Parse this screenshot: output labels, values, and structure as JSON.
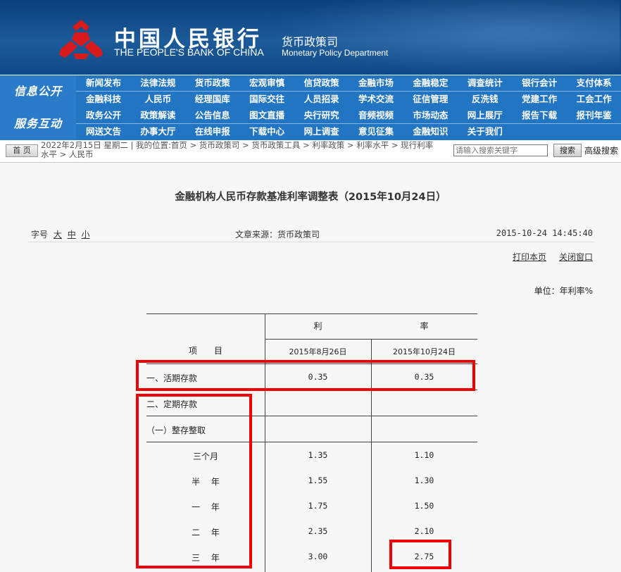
{
  "header": {
    "bank_name_cn": "中国人民银行",
    "bank_name_en": "THE PEOPLE'S BANK OF CHINA",
    "dept_cn": "货币政策司",
    "dept_en": "Monetary Policy Department",
    "brand_color": "#1c5a99",
    "logo_color": "#d71a1a"
  },
  "nav": {
    "section1_label": "信息公开",
    "section1_row1": [
      "新闻发布",
      "法律法规",
      "货币政策",
      "宏观审慎",
      "信贷政策",
      "金融市场",
      "金融稳定",
      "调查统计",
      "银行会计",
      "支付体系"
    ],
    "section1_row2": [
      "金融科技",
      "人民币",
      "经理国库",
      "国际交往",
      "人员招录",
      "学术交流",
      "征信管理",
      "反洗钱",
      "党建工作",
      "工会工作"
    ],
    "section2_label": "服务互动",
    "section2_row1": [
      "政务公开",
      "政策解读",
      "公告信息",
      "图文直播",
      "央行研究",
      "音频视频",
      "市场动态",
      "网上展厅",
      "报告下载",
      "报刊年鉴"
    ],
    "section2_row2": [
      "网送文告",
      "办事大厅",
      "在线申报",
      "下载中心",
      "网上调查",
      "意见征集",
      "金融知识",
      "关于我们"
    ]
  },
  "breadcrumb": {
    "home_label": "首 页",
    "text": "2022年2月15日 星期二 | 我的位置:首页 > 货币政策司 > 货币政策工具 > 利率政策 > 利率水平 > 现行利率水平 > 人民币",
    "search_placeholder": "请输入搜索关键字",
    "search_button": "搜索",
    "advanced_search": "高级搜索"
  },
  "article": {
    "title": "金融机构人民币存款基准利率调整表（2015年10月24日）",
    "font_size_label": "字号",
    "font_large": "大",
    "font_medium": "中",
    "font_small": "小",
    "source": "文章来源：货币政策司",
    "date": "2015-10-24 14:45:40",
    "print": "打印本页",
    "close": "关闭窗口",
    "unit": "单位：年利率%"
  },
  "table": {
    "header_item": "项　　目",
    "header_rate_1": "利",
    "header_rate_2": "率",
    "col_a": "2015年8月26日",
    "col_b": "2015年10月24日",
    "rows": [
      {
        "label": "一、活期存款",
        "a": "0.35",
        "b": "0.35"
      },
      {
        "label": "二、定期存款",
        "a": "",
        "b": ""
      },
      {
        "label": "（一）整存整取",
        "a": "",
        "b": ""
      },
      {
        "label": "三个月",
        "a": "1.35",
        "b": "1.10"
      },
      {
        "label": "半　 年",
        "a": "1.55",
        "b": "1.30"
      },
      {
        "label": "一　 年",
        "a": "1.75",
        "b": "1.50"
      },
      {
        "label": "二　 年",
        "a": "2.35",
        "b": "2.10"
      },
      {
        "label": "三　 年",
        "a": "3.00",
        "b": "2.75"
      }
    ]
  },
  "annotations": {
    "color": "#ee0000"
  }
}
